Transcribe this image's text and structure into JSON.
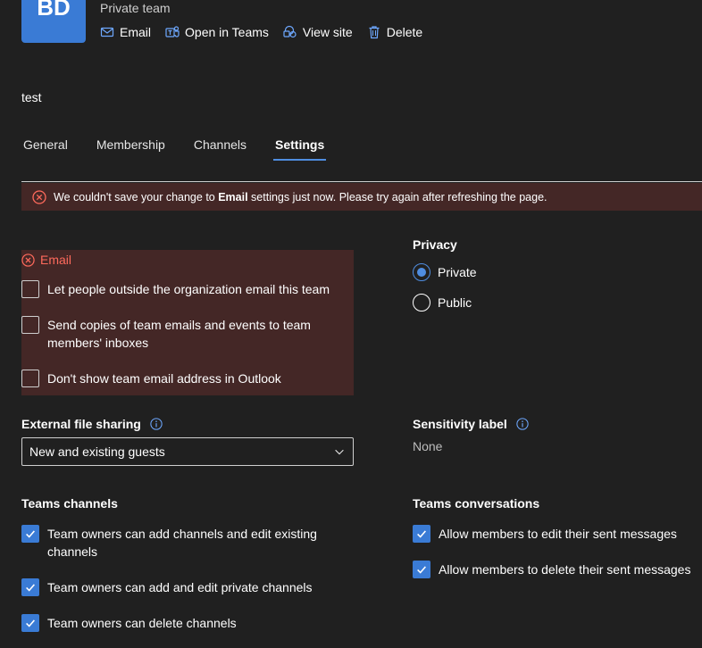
{
  "header": {
    "avatar_initials": "BD",
    "subtitle": "Private team",
    "actions": [
      {
        "label": "Email",
        "icon": "mail-icon"
      },
      {
        "label": "Open in Teams",
        "icon": "teams-icon"
      },
      {
        "label": "View site",
        "icon": "sharepoint-icon"
      },
      {
        "label": "Delete",
        "icon": "trash-icon"
      }
    ],
    "description": "test"
  },
  "tabs": [
    {
      "label": "General",
      "active": false
    },
    {
      "label": "Membership",
      "active": false
    },
    {
      "label": "Channels",
      "active": false
    },
    {
      "label": "Settings",
      "active": true
    }
  ],
  "error_banner": {
    "prefix": "We couldn't save your change to ",
    "bold": "Email",
    "suffix": " settings just now. Please try again after refreshing the page."
  },
  "email": {
    "title": "Email",
    "options": [
      {
        "label": "Let people outside the organization email this team",
        "checked": false
      },
      {
        "label": "Send copies of team emails and events to team members' inboxes",
        "checked": false
      },
      {
        "label": "Don't show team email address in Outlook",
        "checked": false
      }
    ]
  },
  "privacy": {
    "title": "Privacy",
    "options": [
      {
        "label": "Private",
        "selected": true
      },
      {
        "label": "Public",
        "selected": false
      }
    ]
  },
  "external_sharing": {
    "title": "External file sharing",
    "value": "New and existing guests"
  },
  "sensitivity": {
    "title": "Sensitivity label",
    "value": "None"
  },
  "teams_channels": {
    "title": "Teams channels",
    "options": [
      {
        "label": "Team owners can add channels and edit existing channels",
        "checked": true
      },
      {
        "label": "Team owners can add and edit private channels",
        "checked": true
      },
      {
        "label": "Team owners can delete channels",
        "checked": true
      }
    ]
  },
  "teams_conversations": {
    "title": "Teams conversations",
    "options": [
      {
        "label": "Allow members to edit their sent messages",
        "checked": true
      },
      {
        "label": "Allow members to delete their sent messages",
        "checked": true
      }
    ]
  },
  "colors": {
    "accent": "#3a7bd5",
    "error_bg": "#442726",
    "error_text": "#ff6a5c",
    "background": "#202020"
  }
}
